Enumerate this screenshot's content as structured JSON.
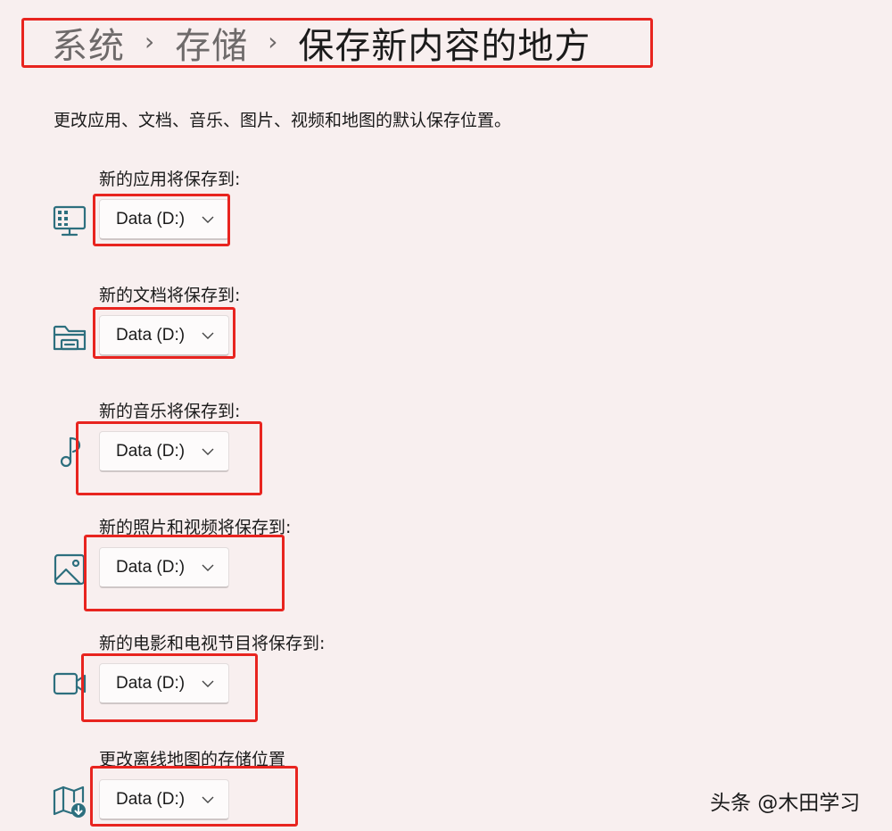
{
  "breadcrumb": {
    "items": [
      "系统",
      "存储"
    ],
    "separator": "›",
    "current": "保存新内容的地方"
  },
  "description": "更改应用、文档、音乐、图片、视频和地图的默认保存位置。",
  "settings": [
    {
      "label": "新的应用将保存到:",
      "value": "Data (D:)",
      "icon": "apps-monitor-icon"
    },
    {
      "label": "新的文档将保存到:",
      "value": "Data (D:)",
      "icon": "folder-document-icon"
    },
    {
      "label": "新的音乐将保存到:",
      "value": "Data (D:)",
      "icon": "music-note-icon"
    },
    {
      "label": "新的照片和视频将保存到:",
      "value": "Data (D:)",
      "icon": "image-icon"
    },
    {
      "label": "新的电影和电视节目将保存到:",
      "value": "Data (D:)",
      "icon": "video-camera-icon"
    },
    {
      "label": "更改离线地图的存储位置",
      "value": "Data (D:)",
      "icon": "map-download-icon"
    }
  ],
  "watermark": "头条 @木田学习",
  "colors": {
    "background": "#f8efef",
    "highlight": "#e8241f",
    "icon": "#2d6f7e"
  }
}
